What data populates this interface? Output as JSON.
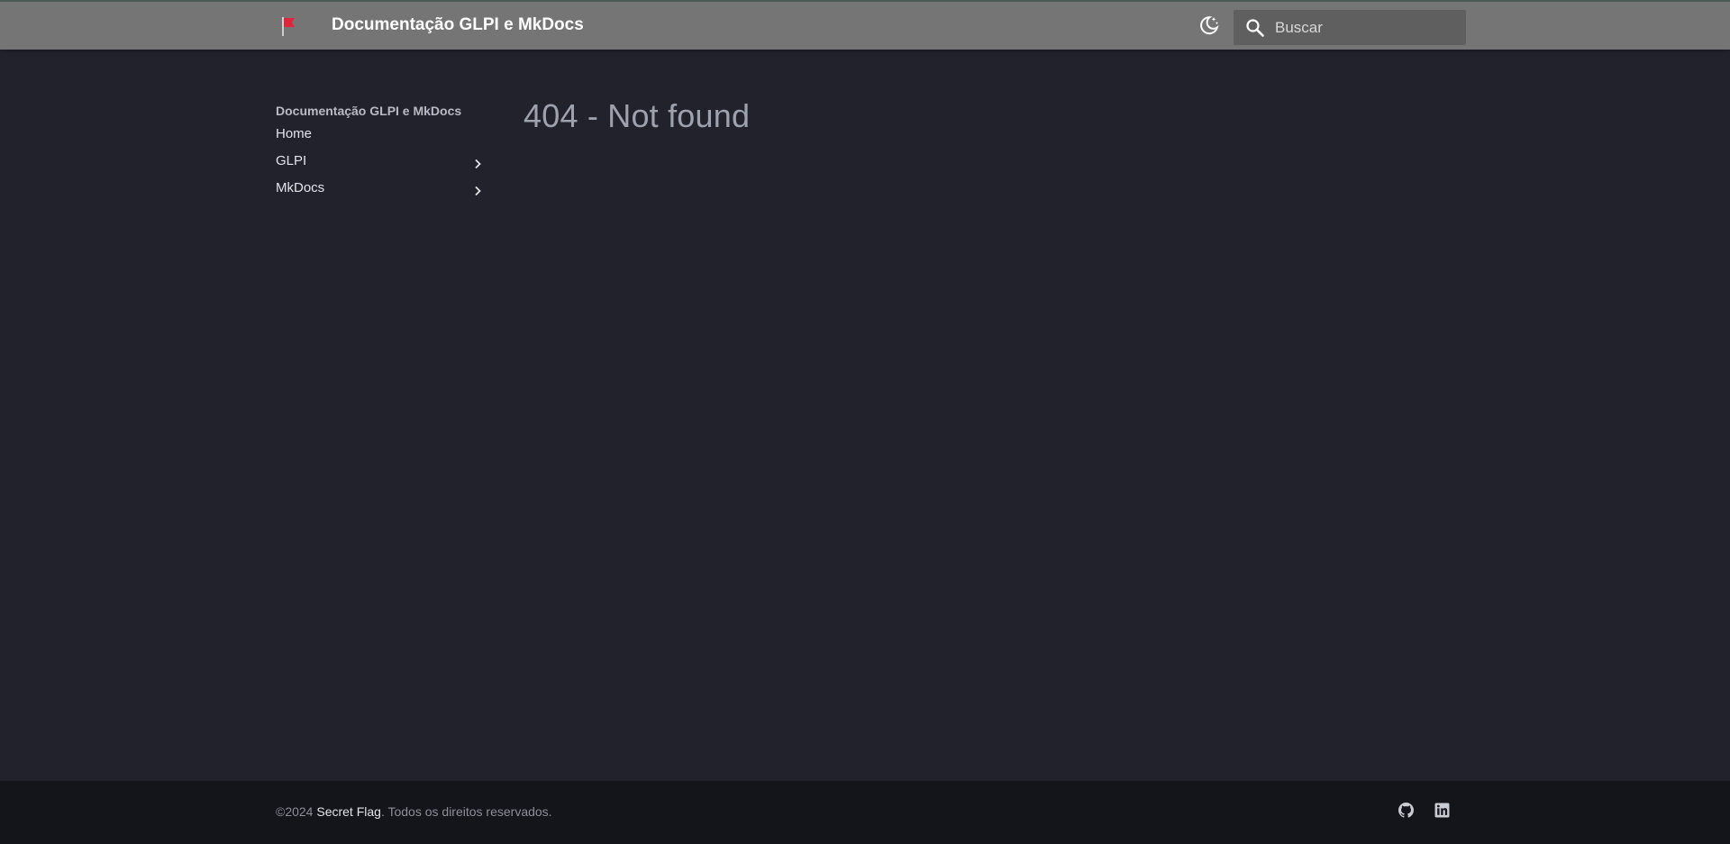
{
  "header": {
    "logo_icon": "flag-icon",
    "title": "Documentação GLPI e MkDocs",
    "theme_toggle_icon": "moon-stars-icon",
    "search": {
      "icon": "search-icon",
      "placeholder": "Buscar",
      "value": ""
    }
  },
  "nav": {
    "title": "Documentação GLPI e MkDocs",
    "items": [
      {
        "label": "Home",
        "expandable": false
      },
      {
        "label": "GLPI",
        "expandable": true
      },
      {
        "label": "MkDocs",
        "expandable": true
      }
    ]
  },
  "content": {
    "title": "404 - Not found"
  },
  "footer": {
    "copyright_prefix": "©2024 ",
    "copyright_link": "Secret Flag",
    "copyright_suffix": ". Todos os direitos reservados.",
    "social": [
      {
        "icon": "github-icon"
      },
      {
        "icon": "linkedin-icon"
      }
    ]
  },
  "colors": {
    "header_bg": "#757575",
    "page_bg": "#21222c",
    "footer_bg": "#14151a",
    "flag_red": "#e0243c"
  }
}
